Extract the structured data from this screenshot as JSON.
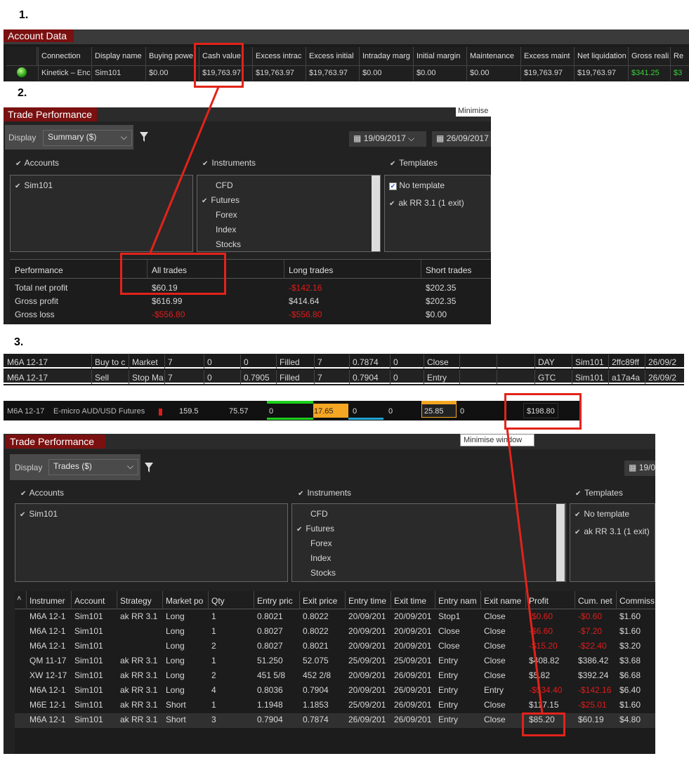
{
  "labels": {
    "one": "1.",
    "two": "2.",
    "three": "3."
  },
  "account": {
    "tab": "Account Data",
    "headers": [
      "Connection",
      "Display name",
      "Buying powe",
      "Cash value",
      "Excess intrac",
      "Excess initial",
      "Intraday marg",
      "Initial margin",
      "Maintenance",
      "Excess maint",
      "Net liquidation",
      "Gross realize",
      "Re"
    ],
    "row": [
      "Kinetick – Enc",
      "Sim101",
      "$0.00",
      "$19,763.97",
      "$19,763.97",
      "$19,763.97",
      "$0.00",
      "$0.00",
      "$0.00",
      "$19,763.97",
      "$19,763.97",
      "$341.25",
      "$3"
    ]
  },
  "perf1": {
    "tab": "Trade Performance",
    "minimise": "Minimise",
    "display_label": "Display",
    "display_value": "Summary ($)",
    "date_from": "19/09/2017",
    "date_to": "26/09/2017",
    "accounts_label": "Accounts",
    "instruments_label": "Instruments",
    "templates_label": "Templates",
    "accounts": [
      "Sim101"
    ],
    "instruments": [
      "CFD",
      "Futures",
      "Forex",
      "Index",
      "Stocks"
    ],
    "templates": [
      "No template",
      "ak RR 3.1 (1 exit)"
    ],
    "headers": [
      "Performance",
      "All trades",
      "Long trades",
      "Short trades"
    ],
    "rows": [
      [
        "Total net profit",
        "$60.19",
        "-$142.16",
        "$202.35"
      ],
      [
        "Gross profit",
        "$616.99",
        "$414.64",
        "$202.35"
      ],
      [
        "Gross loss",
        "-$556.80",
        "-$556.80",
        "$0.00"
      ]
    ]
  },
  "orders": {
    "rows": [
      [
        "M6A 12-17",
        "Buy to c",
        "Market",
        "7",
        "0",
        "0",
        "Filled",
        "7",
        "0.7874",
        "0",
        "Close",
        "",
        "",
        "DAY",
        "Sim101",
        "2ffc89ff",
        "26/09/2"
      ],
      [
        "M6A 12-17",
        "Sell",
        "Stop Ma",
        "7",
        "0",
        "0.7905",
        "Filled",
        "7",
        "0.7904",
        "0",
        "Entry",
        "",
        "",
        "GTC",
        "Sim101",
        "a17a4a",
        "26/09/2"
      ]
    ]
  },
  "position": [
    "M6A 12-17",
    "E-micro AUD/USD Futures",
    "159.5",
    "75.57",
    "0",
    "17.65",
    "0",
    "0",
    "25.85",
    "0",
    "$198.80"
  ],
  "perf2": {
    "tab": "Trade Performance",
    "tooltip": "Minimise window",
    "display_label": "Display",
    "display_value": "Trades ($)",
    "date_from": "19/0",
    "accounts_label": "Accounts",
    "instruments_label": "Instruments",
    "templates_label": "Templates",
    "accounts": [
      "Sim101"
    ],
    "instruments": [
      "CFD",
      "Futures",
      "Forex",
      "Index",
      "Stocks"
    ],
    "templates": [
      "No template",
      "ak RR 3.1 (1 exit)"
    ],
    "headers": [
      "Instrumer",
      "Account",
      "Strategy",
      "Market po",
      "Qty",
      "Entry pric",
      "Exit price",
      "Entry time",
      "Exit time",
      "Entry nam",
      "Exit name",
      "Profit",
      "Cum. net",
      "Commiss"
    ],
    "rows": [
      [
        "M6A 12-1",
        "Sim101",
        "ak RR 3.1",
        "Long",
        "1",
        "0.8021",
        "0.8022",
        "20/09/201",
        "20/09/201",
        "Stop1",
        "Close",
        "-$0.60",
        "-$0.60",
        "$1.60"
      ],
      [
        "M6A 12-1",
        "Sim101",
        "",
        "Long",
        "1",
        "0.8027",
        "0.8022",
        "20/09/201",
        "20/09/201",
        "Close",
        "Close",
        "-$6.60",
        "-$7.20",
        "$1.60"
      ],
      [
        "M6A 12-1",
        "Sim101",
        "",
        "Long",
        "2",
        "0.8027",
        "0.8021",
        "20/09/201",
        "20/09/201",
        "Close",
        "Close",
        "-$15.20",
        "-$22.40",
        "$3.20"
      ],
      [
        "QM 11-17",
        "Sim101",
        "ak RR 3.1",
        "Long",
        "1",
        "51.250",
        "52.075",
        "25/09/201",
        "25/09/201",
        "Entry",
        "Close",
        "$408.82",
        "$386.42",
        "$3.68"
      ],
      [
        "XW 12-17",
        "Sim101",
        "ak RR 3.1",
        "Long",
        "2",
        "451 5/8",
        "452 2/8",
        "20/09/201",
        "26/09/201",
        "Entry",
        "Close",
        "$5.82",
        "$392.24",
        "$6.68"
      ],
      [
        "M6A 12-1",
        "Sim101",
        "ak RR 3.1",
        "Long",
        "4",
        "0.8036",
        "0.7904",
        "20/09/201",
        "26/09/201",
        "Entry",
        "Entry",
        "-$534.40",
        "-$142.16",
        "$6.40"
      ],
      [
        "M6E 12-1",
        "Sim101",
        "ak RR 3.1",
        "Short",
        "1",
        "1.1948",
        "1.1853",
        "25/09/201",
        "26/09/201",
        "Entry",
        "Close",
        "$117.15",
        "-$25.01",
        "$1.60"
      ],
      [
        "M6A 12-1",
        "Sim101",
        "ak RR 3.1",
        "Short",
        "3",
        "0.7904",
        "0.7874",
        "26/09/201",
        "26/09/201",
        "Entry",
        "Close",
        "$85.20",
        "$60.19",
        "$4.80"
      ]
    ]
  }
}
